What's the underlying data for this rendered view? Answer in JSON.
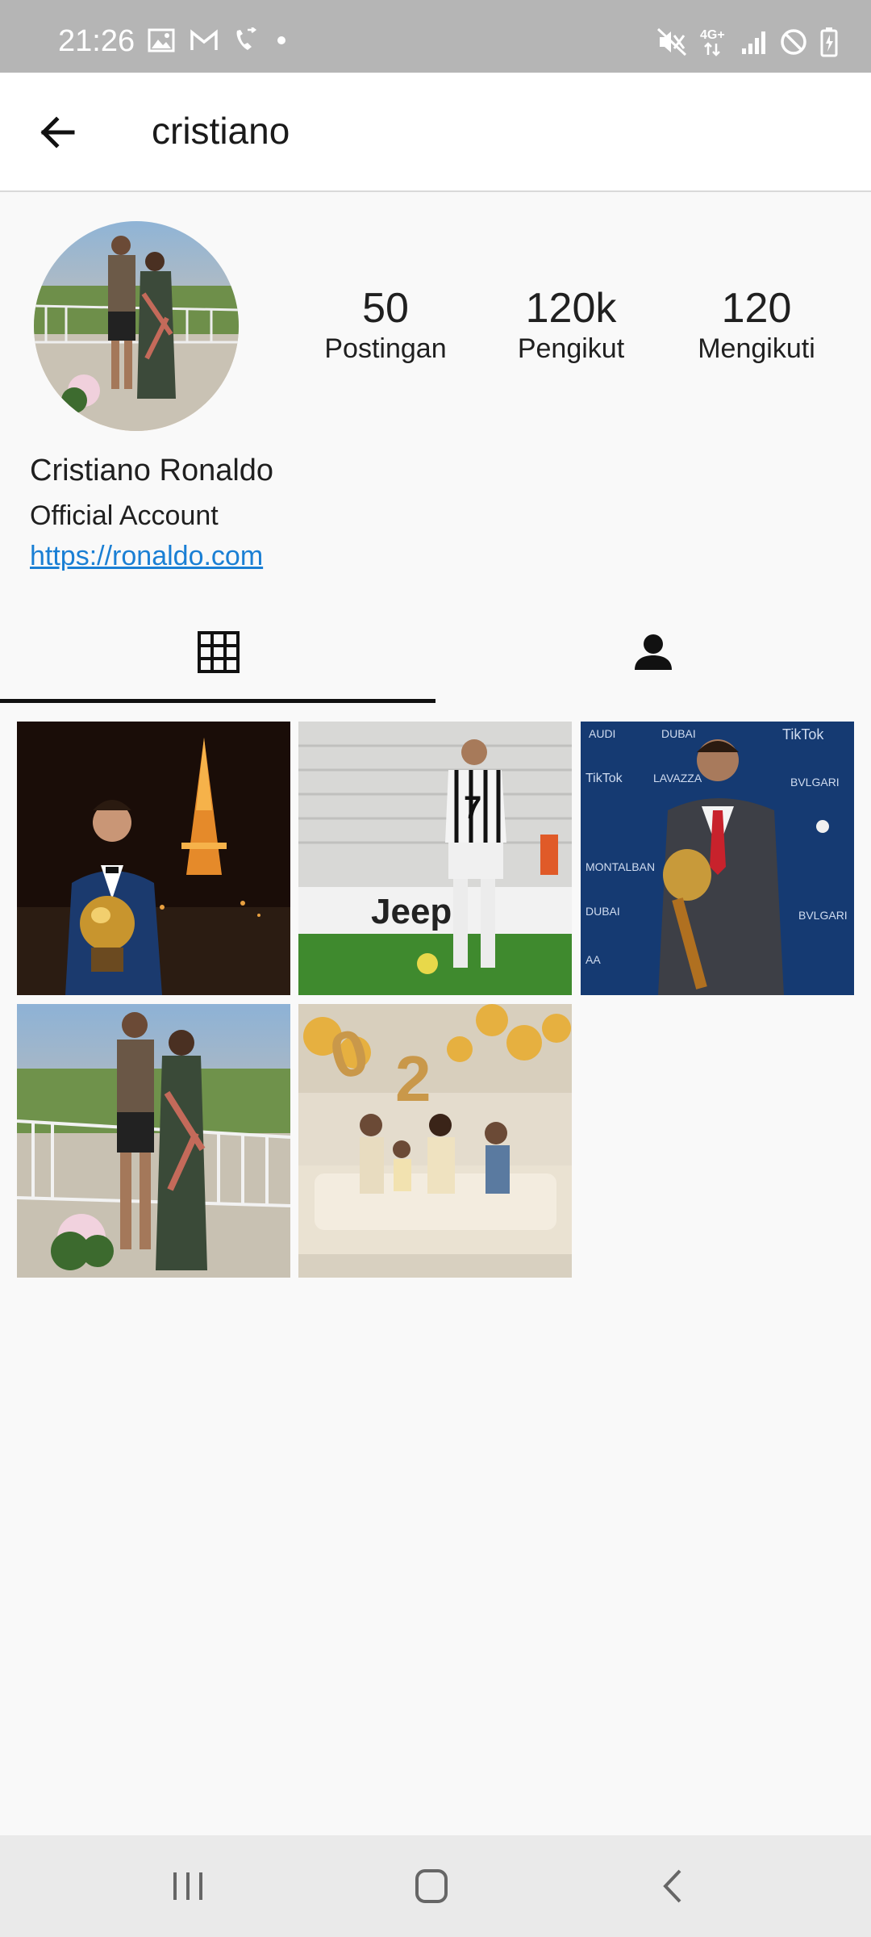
{
  "status_bar": {
    "time": "21:26",
    "left_icons": [
      "image-icon",
      "gmail-icon",
      "phone-forward-icon",
      "dot-icon"
    ],
    "right_icons": [
      "mute-icon",
      "network-4g-icon",
      "signal-icon",
      "dnd-icon",
      "battery-charging-icon"
    ],
    "network_label": "4G+"
  },
  "app_bar": {
    "title": "cristiano",
    "back_icon": "arrow-back-icon"
  },
  "profile": {
    "avatar_icon": "avatar-photo",
    "stats": [
      {
        "value": "50",
        "label": "Postingan"
      },
      {
        "value": "120k",
        "label": "Pengikut"
      },
      {
        "value": "120",
        "label": "Mengikuti"
      }
    ],
    "name": "Cristiano Ronaldo",
    "bio": "Official Account",
    "link": "https://ronaldo.com"
  },
  "tabs": [
    {
      "icon": "grid-icon",
      "selected": true
    },
    {
      "icon": "person-tag-icon",
      "selected": false
    }
  ],
  "posts": [
    {
      "name": "post-ballon-dor-paris"
    },
    {
      "name": "post-juventus-match"
    },
    {
      "name": "post-globe-soccer-award"
    },
    {
      "name": "post-sunset-terrace"
    },
    {
      "name": "post-family-celebration"
    }
  ],
  "nav_bar": {
    "buttons": [
      "recents-icon",
      "home-icon",
      "back-icon"
    ]
  },
  "colors": {
    "status_bar": "#b5b5b5",
    "link": "#1a7fd4",
    "background": "#f9f9f9"
  }
}
